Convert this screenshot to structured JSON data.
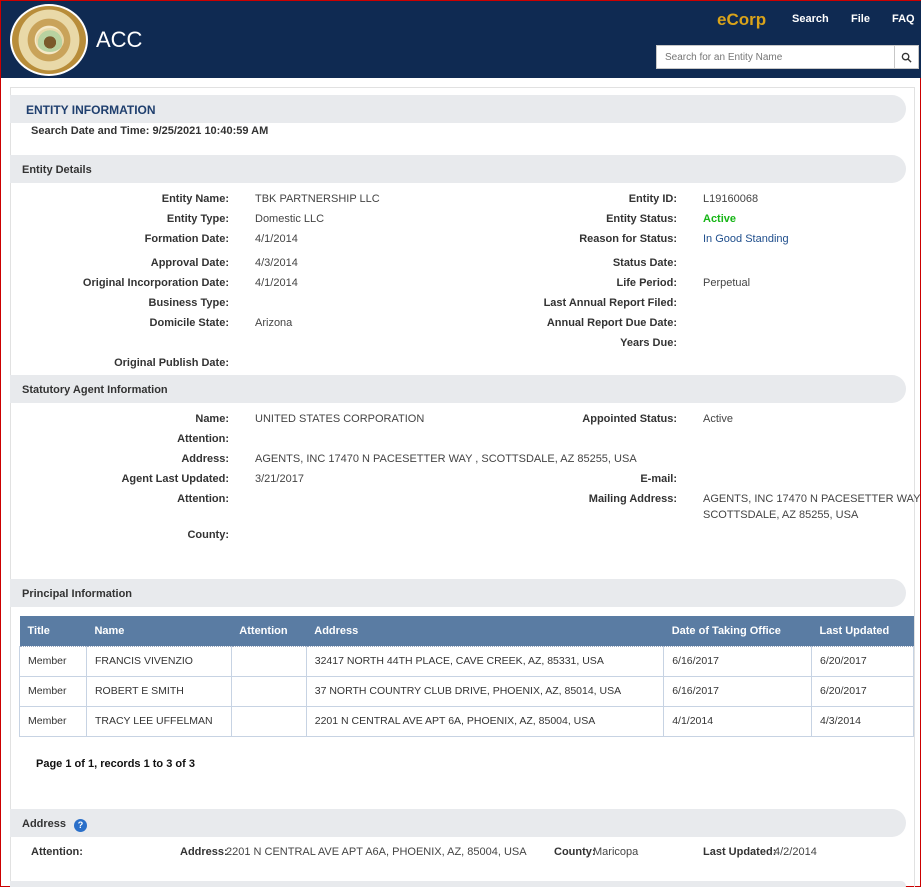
{
  "header": {
    "app_title": "ACC",
    "brand": "eCorp",
    "nav": [
      "Search",
      "File",
      "FAQ"
    ],
    "search_placeholder": "Search for an Entity Name"
  },
  "entity_info": {
    "title": "ENTITY INFORMATION",
    "search_datetime": "Search Date and Time: 9/25/2021 10:40:59 AM"
  },
  "entity_details": {
    "title": "Entity Details",
    "left": [
      {
        "label": "Entity Name:",
        "value": "TBK PARTNERSHIP LLC"
      },
      {
        "label": "Entity Type:",
        "value": "Domestic LLC"
      },
      {
        "label": "Formation Date:",
        "value": "4/1/2014"
      },
      {
        "label": "Approval Date:",
        "value": "4/3/2014"
      },
      {
        "label": "Original Incorporation Date:",
        "value": "4/1/2014"
      },
      {
        "label": "Business Type:",
        "value": ""
      },
      {
        "label": "Domicile State:",
        "value": "Arizona"
      },
      {
        "label": "Original Publish Date:",
        "value": ""
      }
    ],
    "right": [
      {
        "label": "Entity ID:",
        "value": "L19160068"
      },
      {
        "label": "Entity Status:",
        "value": "Active"
      },
      {
        "label": "Reason for Status:",
        "value": "In Good Standing"
      },
      {
        "label": "Status Date:",
        "value": ""
      },
      {
        "label": "Life Period:",
        "value": "Perpetual"
      },
      {
        "label": "Last Annual Report Filed:",
        "value": ""
      },
      {
        "label": "Annual Report Due Date:",
        "value": ""
      },
      {
        "label": "Years Due:",
        "value": ""
      }
    ]
  },
  "statutory_agent": {
    "title": "Statutory Agent Information",
    "left": [
      {
        "label": "Name:",
        "value": "UNITED STATES CORPORATION"
      },
      {
        "label": "Attention:",
        "value": ""
      },
      {
        "label": "Address:",
        "value": "AGENTS, INC 17470 N PACESETTER WAY , SCOTTSDALE, AZ 85255, USA"
      },
      {
        "label": "Agent Last Updated:",
        "value": "3/21/2017"
      },
      {
        "label": "Attention:",
        "value": ""
      },
      {
        "label": "County:",
        "value": ""
      }
    ],
    "right": [
      {
        "label": "Appointed Status:",
        "value": "Active"
      },
      {
        "label": "E-mail:",
        "value": ""
      },
      {
        "label": "Mailing Address:",
        "value": "AGENTS, INC 17470 N PACESETTER WAY ,",
        "value2": "SCOTTSDALE, AZ 85255, USA"
      }
    ]
  },
  "principal": {
    "title": "Principal Information",
    "columns": [
      "Title",
      "Name",
      "Attention",
      "Address",
      "Date of Taking Office",
      "Last Updated"
    ],
    "rows": [
      [
        "Member",
        "FRANCIS VIVENZIO",
        "",
        "32417 NORTH 44TH PLACE, CAVE CREEK, AZ, 85331, USA",
        "6/16/2017",
        "6/20/2017"
      ],
      [
        "Member",
        "ROBERT E SMITH",
        "",
        "37 NORTH COUNTRY CLUB DRIVE, PHOENIX, AZ, 85014, USA",
        "6/16/2017",
        "6/20/2017"
      ],
      [
        "Member",
        "TRACY LEE UFFELMAN",
        "",
        "2201 N CENTRAL AVE APT 6A, PHOENIX, AZ, 85004, USA",
        "4/1/2014",
        "4/3/2014"
      ]
    ],
    "pager": "Page 1 of 1, records 1 to 3 of 3"
  },
  "address": {
    "title": "Address",
    "attention_label": "Attention:",
    "address_label": "Address:",
    "address_value": "2201 N CENTRAL AVE APT A6A, PHOENIX, AZ, 85004, USA",
    "county_label": "County:",
    "county_value": "Maricopa",
    "updated_label": "Last Updated:",
    "updated_value": "4/2/2014"
  },
  "colors": {
    "header_bg": "#0f2a52",
    "brand": "#d9a31a",
    "table_header": "#5a7ca3",
    "active": "#16b516"
  },
  "icons": [
    "state-seal-icon",
    "search-icon",
    "help-icon"
  ]
}
